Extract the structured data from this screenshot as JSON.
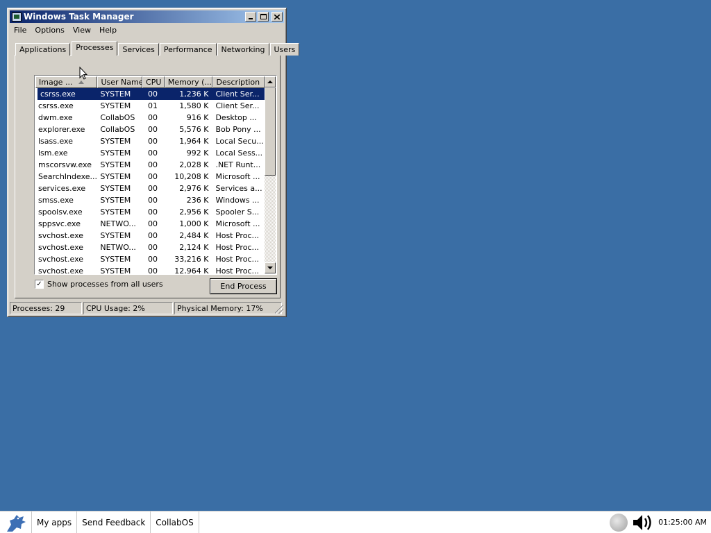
{
  "window": {
    "title": "Windows Task Manager",
    "menu": [
      "File",
      "Options",
      "View",
      "Help"
    ],
    "tabs": [
      "Applications",
      "Processes",
      "Services",
      "Performance",
      "Networking",
      "Users"
    ],
    "active_tab": "Processes"
  },
  "processes": {
    "columns": [
      "Image ...",
      "User Name",
      "CPU",
      "Memory (...",
      "Description"
    ],
    "rows": [
      [
        "csrss.exe",
        "SYSTEM",
        "00",
        "1,236 K",
        "Client Ser..."
      ],
      [
        "csrss.exe",
        "SYSTEM",
        "01",
        "1,580 K",
        "Client Ser..."
      ],
      [
        "dwm.exe",
        "CollabOS",
        "00",
        "916 K",
        "Desktop ..."
      ],
      [
        "explorer.exe",
        "CollabOS",
        "00",
        "5,576 K",
        "Bob Pony ..."
      ],
      [
        "lsass.exe",
        "SYSTEM",
        "00",
        "1,964 K",
        "Local Secu..."
      ],
      [
        "lsm.exe",
        "SYSTEM",
        "00",
        "992 K",
        "Local Sess..."
      ],
      [
        "mscorsvw.exe",
        "SYSTEM",
        "00",
        "2,028 K",
        ".NET Runt..."
      ],
      [
        "SearchIndexe...",
        "SYSTEM",
        "00",
        "10,208 K",
        "Microsoft ..."
      ],
      [
        "services.exe",
        "SYSTEM",
        "00",
        "2,976 K",
        "Services a..."
      ],
      [
        "smss.exe",
        "SYSTEM",
        "00",
        "236 K",
        "Windows ..."
      ],
      [
        "spoolsv.exe",
        "SYSTEM",
        "00",
        "2,956 K",
        "Spooler S..."
      ],
      [
        "sppsvc.exe",
        "NETWO...",
        "00",
        "1,000 K",
        "Microsoft ..."
      ],
      [
        "svchost.exe",
        "SYSTEM",
        "00",
        "2,484 K",
        "Host Proc..."
      ],
      [
        "svchost.exe",
        "NETWO...",
        "00",
        "2,124 K",
        "Host Proc..."
      ],
      [
        "svchost.exe",
        "SYSTEM",
        "00",
        "33,216 K",
        "Host Proc..."
      ],
      [
        "svchost.exe",
        "SYSTEM",
        "00",
        "12,964 K",
        "Host Proc..."
      ]
    ],
    "selected_row": 0,
    "show_all_users_label": "Show processes from all users",
    "show_all_users_checked": true,
    "end_process_label": "End Process"
  },
  "status": {
    "processes": "Processes: 29",
    "cpu": "CPU Usage: 2%",
    "memory": "Physical Memory: 17%"
  },
  "taskbar": {
    "items": [
      "My apps",
      "Send Feedback",
      "CollabOS"
    ],
    "clock": "01:25:00 AM"
  }
}
